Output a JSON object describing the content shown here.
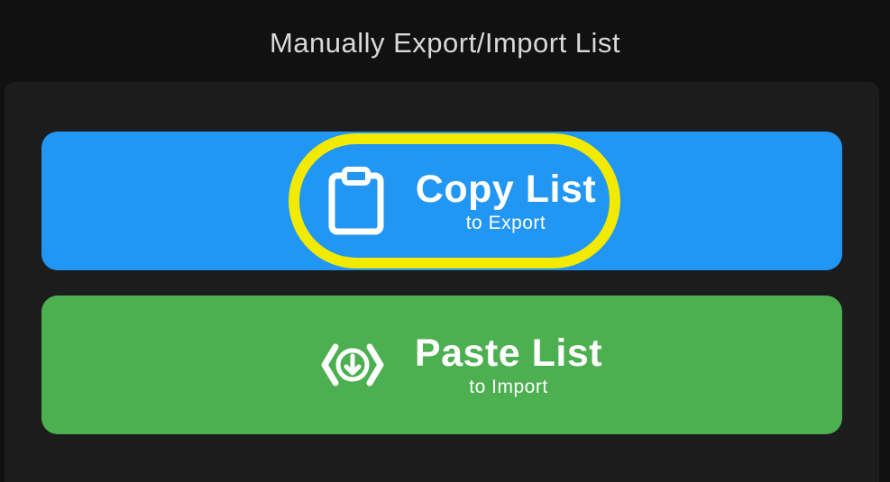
{
  "header": {
    "title": "Manually Export/Import List"
  },
  "copy_button": {
    "label": "Copy List",
    "sublabel": "to Export",
    "icon": "clipboard-icon",
    "color": "#2196f3"
  },
  "paste_button": {
    "label": "Paste List",
    "sublabel": "to Import",
    "icon": "import-code-icon",
    "color": "#4caf50"
  },
  "highlight": {
    "color": "#f2ea00",
    "target": "copy_button"
  }
}
